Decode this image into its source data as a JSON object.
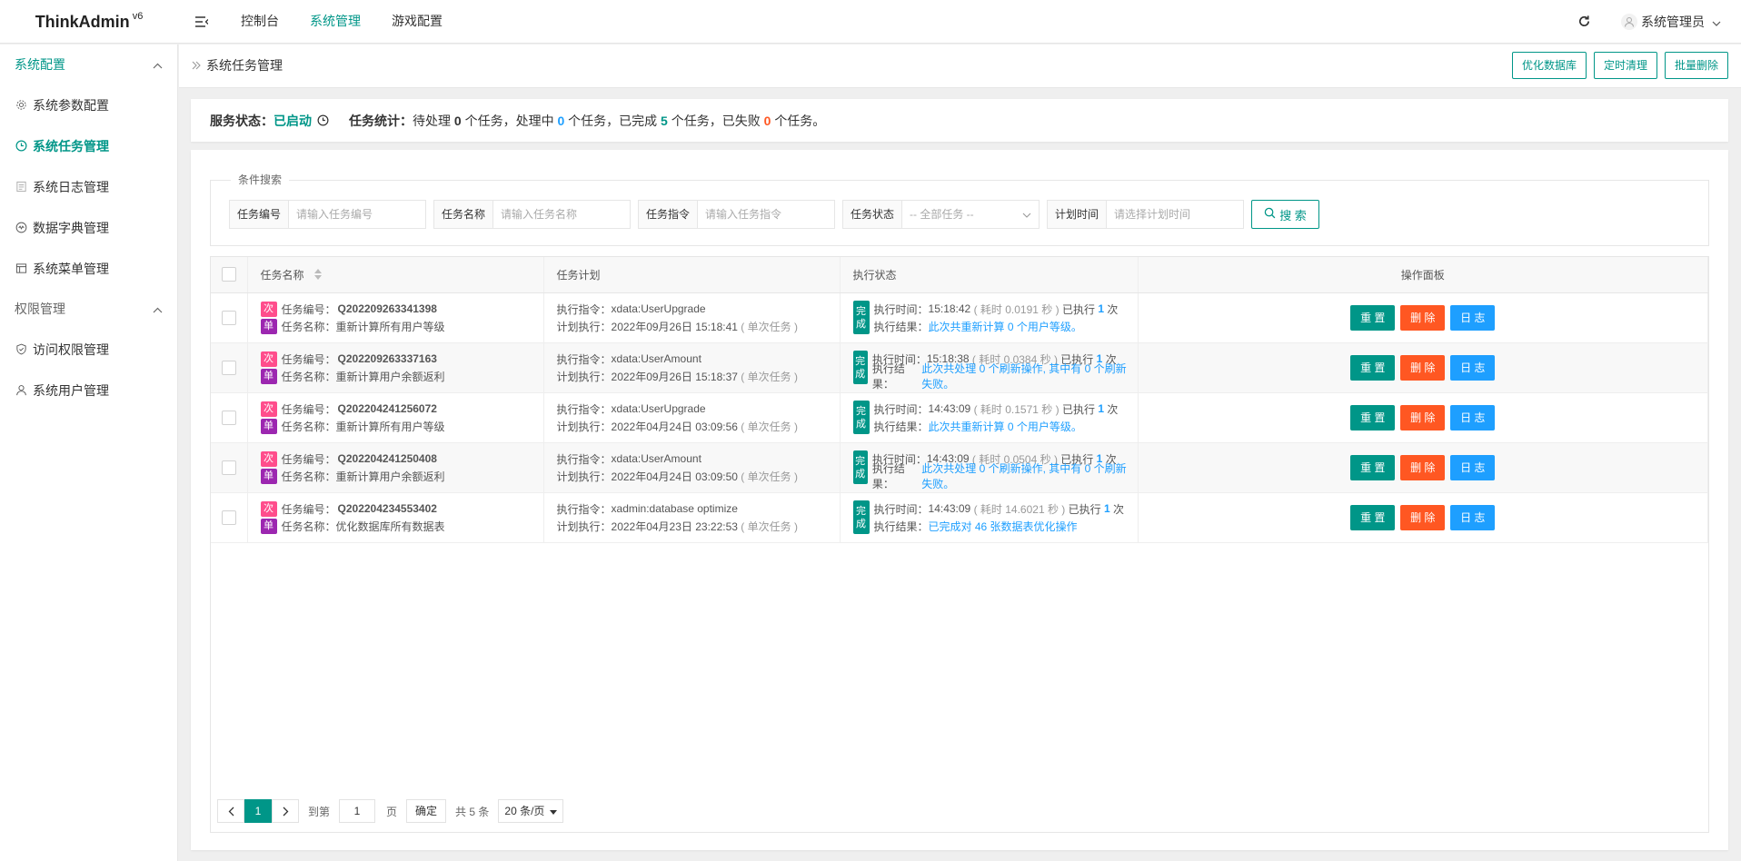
{
  "brand": {
    "name": "ThinkAdmin",
    "version": "v6"
  },
  "top_nav": [
    {
      "label": "控制台",
      "active": false
    },
    {
      "label": "系统管理",
      "active": true
    },
    {
      "label": "游戏配置",
      "active": false
    }
  ],
  "user": {
    "name": "系统管理员"
  },
  "sidebar": {
    "groups": [
      {
        "title": "系统配置",
        "open": true,
        "items": [
          {
            "label": "系统参数配置",
            "icon": "gear-icon",
            "active": false
          },
          {
            "label": "系统任务管理",
            "icon": "clock-icon",
            "active": true
          },
          {
            "label": "系统日志管理",
            "icon": "log-icon",
            "active": false
          },
          {
            "label": "数据字典管理",
            "icon": "dictionary-icon",
            "active": false
          },
          {
            "label": "系统菜单管理",
            "icon": "menu-icon",
            "active": false
          }
        ]
      },
      {
        "title": "权限管理",
        "open": false,
        "items": [
          {
            "label": "访问权限管理",
            "icon": "shield-icon",
            "active": false
          },
          {
            "label": "系统用户管理",
            "icon": "user-icon",
            "active": false
          }
        ]
      }
    ]
  },
  "breadcrumb": {
    "title": "系统任务管理"
  },
  "header_actions": {
    "optimize": "优化数据库",
    "timed_clean": "定时清理",
    "batch_delete": "批量删除"
  },
  "status": {
    "service_label": "服务状态：",
    "service_value": "已启动",
    "stats_label": "任务统计：",
    "pending_prefix": "待处理",
    "pending": "0",
    "pending_suffix": "个任务，处理中",
    "processing": "0",
    "processing_suffix": "个任务，已完成",
    "completed": "5",
    "completed_suffix": "个任务，已失败",
    "failed": "0",
    "failed_suffix": "个任务。"
  },
  "search": {
    "legend": "条件搜索",
    "fields": [
      {
        "label": "任务编号",
        "placeholder": "请输入任务编号"
      },
      {
        "label": "任务名称",
        "placeholder": "请输入任务名称"
      },
      {
        "label": "任务指令",
        "placeholder": "请输入任务指令"
      },
      {
        "label": "任务状态",
        "placeholder": "-- 全部任务 --"
      },
      {
        "label": "计划时间",
        "placeholder": "请选择计划时间"
      }
    ],
    "button": "搜 索"
  },
  "table": {
    "headers": {
      "name": "任务名称",
      "plan": "任务计划",
      "exec": "执行状态",
      "ops": "操作面板"
    },
    "labels": {
      "tag_times": "次",
      "tag_single": "单",
      "code_prefix": "任务编号：",
      "name_prefix": "任务名称：",
      "command_prefix": "执行指令：",
      "planned_prefix": "计划执行：",
      "done_1": "完",
      "done_2": "成",
      "time_prefix": "执行时间：",
      "result_prefix": "执行结果：",
      "reset": "重 置",
      "delete": "删 除",
      "log": "日 志"
    },
    "rows": [
      {
        "code": "Q202209263341398",
        "name": "重新计算所有用户等级",
        "command": "xdata:UserUpgrade",
        "planned": "2022年09月26日 15:18:41",
        "planned_note": "( 单次任务 )",
        "exec_time": "15:18:42",
        "elapsed": "( 耗时 0.0191 秒 )",
        "exec_prefix": "已执行",
        "exec_count": "1",
        "exec_suffix": "次",
        "result": "此次共重新计算 0 个用户等级。"
      },
      {
        "code": "Q202209263337163",
        "name": "重新计算用户余额返利",
        "command": "xdata:UserAmount",
        "planned": "2022年09月26日 15:18:37",
        "planned_note": "( 单次任务 )",
        "exec_time": "15:18:38",
        "elapsed": "( 耗时 0.0384 秒 )",
        "exec_prefix": "已执行",
        "exec_count": "1",
        "exec_suffix": "次",
        "result": "此次共处理 0 个刷新操作, 其中有 0 个刷新失败。"
      },
      {
        "code": "Q202204241256072",
        "name": "重新计算所有用户等级",
        "command": "xdata:UserUpgrade",
        "planned": "2022年04月24日 03:09:56",
        "planned_note": "( 单次任务 )",
        "exec_time": "14:43:09",
        "elapsed": "( 耗时 0.1571 秒 )",
        "exec_prefix": "已执行",
        "exec_count": "1",
        "exec_suffix": "次",
        "result": "此次共重新计算 0 个用户等级。"
      },
      {
        "code": "Q202204241250408",
        "name": "重新计算用户余额返利",
        "command": "xdata:UserAmount",
        "planned": "2022年04月24日 03:09:50",
        "planned_note": "( 单次任务 )",
        "exec_time": "14:43:09",
        "elapsed": "( 耗时 0.0504 秒 )",
        "exec_prefix": "已执行",
        "exec_count": "1",
        "exec_suffix": "次",
        "result": "此次共处理 0 个刷新操作, 其中有 0 个刷新失败。"
      },
      {
        "code": "Q202204234553402",
        "name": "优化数据库所有数据表",
        "command": "xadmin:database optimize",
        "planned": "2022年04月23日 23:22:53",
        "planned_note": "( 单次任务 )",
        "exec_time": "14:43:09",
        "elapsed": "( 耗时 14.6021 秒 )",
        "exec_prefix": "已执行",
        "exec_count": "1",
        "exec_suffix": "次",
        "result": "已完成对 46 张数据表优化操作"
      }
    ]
  },
  "pagination": {
    "current": "1",
    "goto_label": "到第",
    "page_input": "1",
    "page_label": "页",
    "confirm": "确定",
    "total": "共 5 条",
    "page_size": "20 条/页"
  },
  "colors": {
    "accent": "#009688",
    "info": "#1e9fff",
    "danger": "#ff5722",
    "tag_pink": "#ff4d8c",
    "tag_purple": "#9c27b0"
  }
}
